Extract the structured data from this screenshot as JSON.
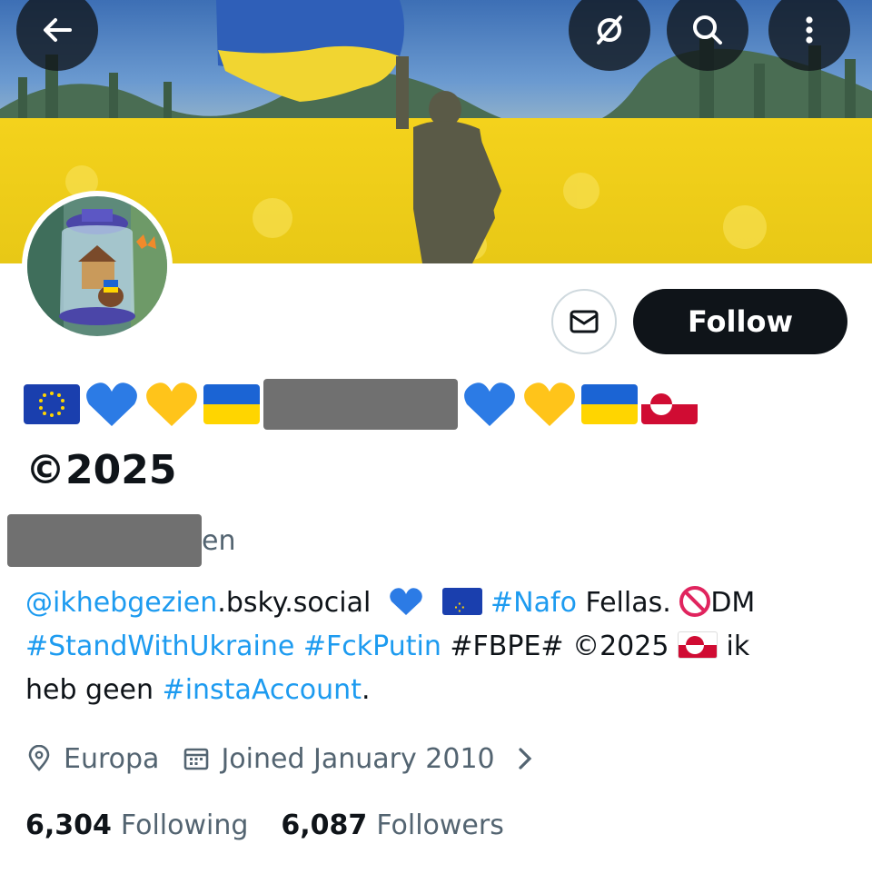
{
  "header": {
    "back_icon": "arrow-left-icon",
    "grok_icon": "slashed-circle-icon",
    "search_icon": "search-icon",
    "more_icon": "vertical-dots-icon"
  },
  "profile": {
    "display_name_suffix": "©2025",
    "handle_visible_tail": "en",
    "follow_label": "Follow",
    "message_icon": "envelope-icon"
  },
  "bio": {
    "bsky_link": "@ikhebgezien",
    "bsky_rest": ".bsky.social",
    "nafo": "#Nafo",
    "fellas": " Fellas. ",
    "dm": "DM",
    "stand": "#StandWithUkraine",
    "fck": "#FckPutin",
    "fbpe": " #FBPE# ",
    "copy2025": "©2025 ",
    "ik": " ik",
    "heb_geen": "heb geen ",
    "insta": "#instaAccount",
    "period": "."
  },
  "meta": {
    "location": "Europa",
    "joined": "Joined January 2010"
  },
  "stats": {
    "following_count": "6,304",
    "following_label": "Following",
    "followers_count": "6,087",
    "followers_label": "Followers"
  },
  "colors": {
    "link": "#1d9bf0",
    "follow_bg": "#0f1419",
    "muted": "#536471",
    "ua_blue": "#1b64d4",
    "ua_yellow": "#ffd500"
  }
}
